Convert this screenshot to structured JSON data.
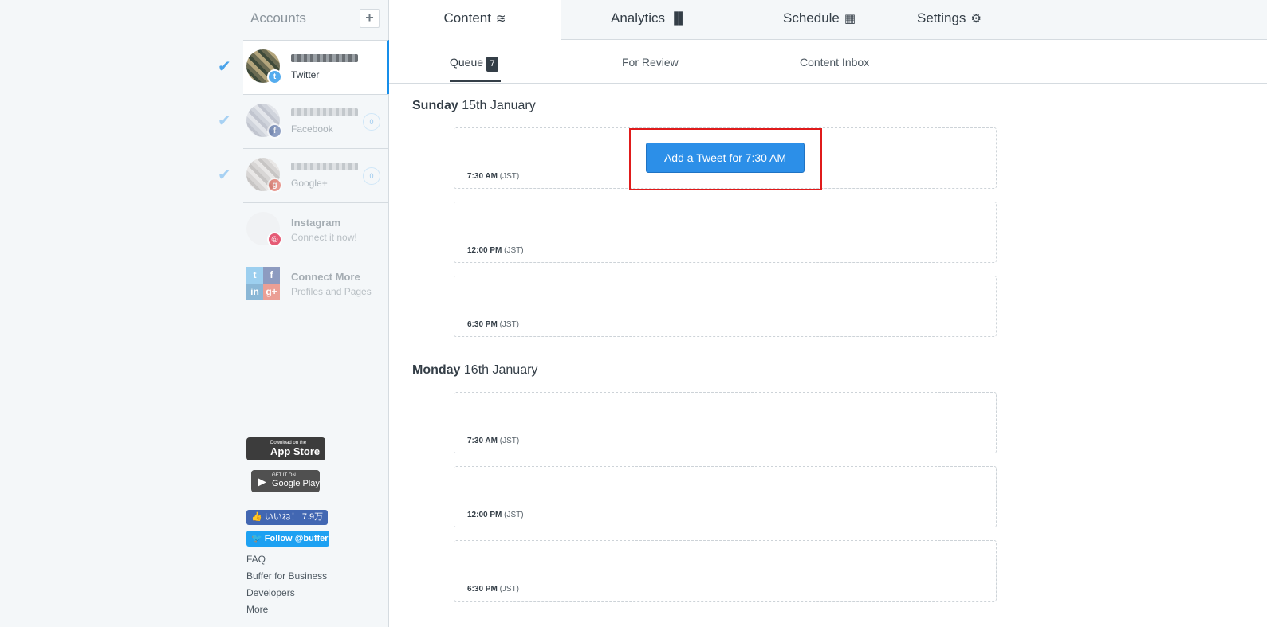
{
  "sidebar": {
    "accounts_title": "Accounts",
    "add_label": "+",
    "accounts": [
      {
        "network": "Twitter",
        "count": ""
      },
      {
        "network": "Facebook",
        "count": "0"
      },
      {
        "network": "Google+",
        "count": "0"
      }
    ],
    "instagram": {
      "title": "Instagram",
      "subtitle": "Connect it now!"
    },
    "connect_more": {
      "title": "Connect More",
      "subtitle": "Profiles and Pages"
    },
    "app_store": {
      "small": "Download on the",
      "big": "App Store"
    },
    "google_play": {
      "small": "GET IT ON",
      "big": "Google Play"
    },
    "fb_like": "いいね！ 7.9万",
    "tw_follow": "Follow @buffer",
    "footer_links": [
      "FAQ",
      "Buffer for Business",
      "Developers",
      "More"
    ]
  },
  "topnav": {
    "tabs": [
      {
        "label": "Content",
        "icon": "layers-icon"
      },
      {
        "label": "Analytics",
        "icon": "bar-chart-icon"
      },
      {
        "label": "Schedule",
        "icon": "calendar-icon"
      },
      {
        "label": "Settings",
        "icon": "gear-icon"
      }
    ]
  },
  "subnav": {
    "tabs": [
      {
        "label": "Queue",
        "count": "7"
      },
      {
        "label": "For Review"
      },
      {
        "label": "Content Inbox"
      }
    ]
  },
  "queue": {
    "days": [
      {
        "weekday": "Sunday",
        "date": "15th January",
        "slots": [
          {
            "time": "7:30 AM",
            "tz": "(JST)"
          },
          {
            "time": "12:00 PM",
            "tz": "(JST)"
          },
          {
            "time": "6:30 PM",
            "tz": "(JST)"
          }
        ]
      },
      {
        "weekday": "Monday",
        "date": "16th January",
        "slots": [
          {
            "time": "7:30 AM",
            "tz": "(JST)"
          },
          {
            "time": "12:00 PM",
            "tz": "(JST)"
          },
          {
            "time": "6:30 PM",
            "tz": "(JST)"
          }
        ]
      }
    ],
    "add_button_label": "Add a Tweet for 7:30 AM"
  },
  "colors": {
    "accent": "#2c8fe8",
    "highlight": "#e01b1b",
    "sidebar_bg": "#f4f7f9"
  }
}
